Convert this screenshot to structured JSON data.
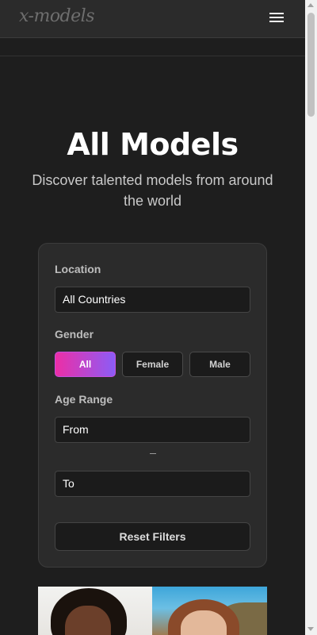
{
  "header": {
    "logo_text": "x-models",
    "menu_icon": "hamburger-menu-icon"
  },
  "hero": {
    "title": "All Models",
    "subtitle": "Discover talented models from around the world"
  },
  "filters": {
    "location_label": "Location",
    "location_value": "All Countries",
    "gender_label": "Gender",
    "gender_options": [
      "All",
      "Female",
      "Male"
    ],
    "gender_selected": "All",
    "age_label": "Age Range",
    "age_from_placeholder": "From",
    "age_to_placeholder": "To",
    "reset_label": "Reset Filters"
  },
  "colors": {
    "background": "#1e1e1e",
    "card": "#2b2b2b",
    "accent_start": "#ec2ea6",
    "accent_end": "#8b5cf6"
  }
}
